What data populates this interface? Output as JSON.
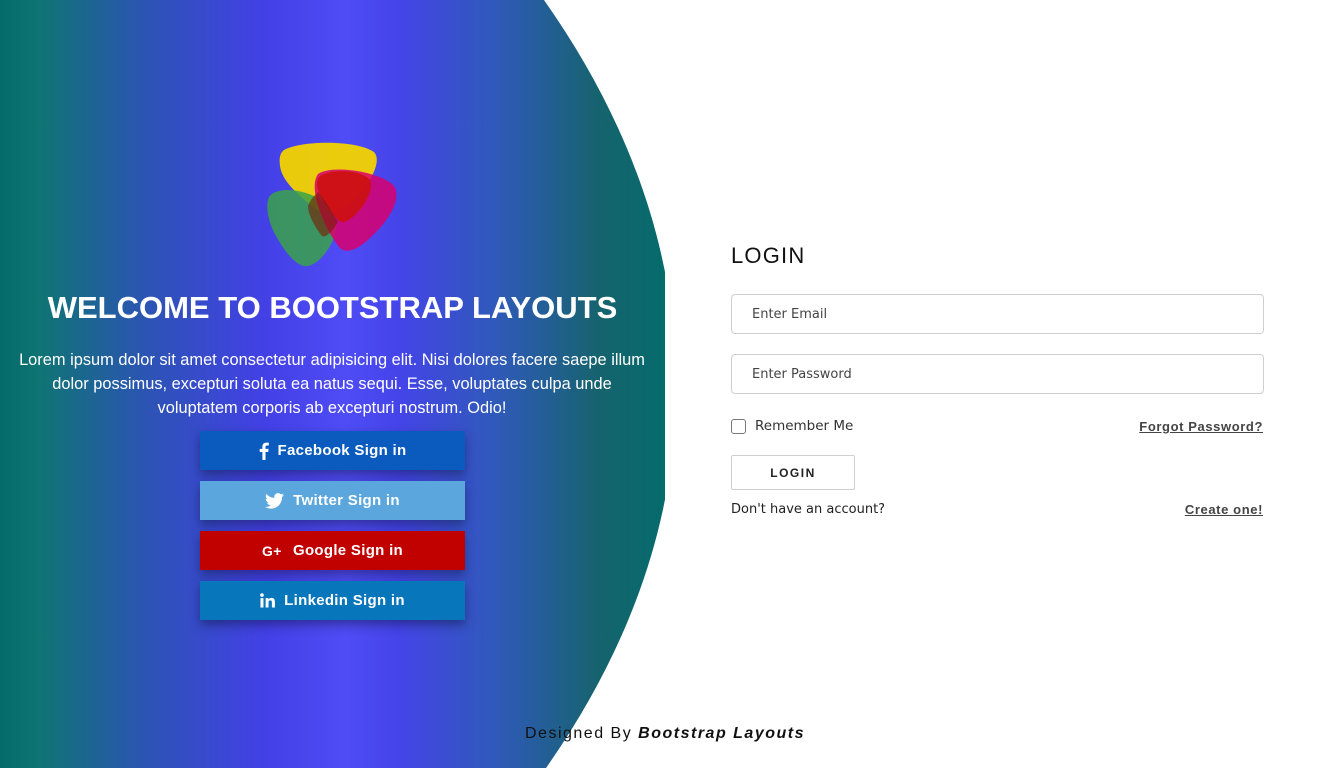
{
  "welcome": {
    "title": "WELCOME TO BOOTSTRAP LAYOUTS",
    "text": "Lorem ipsum dolor sit amet consectetur adipisicing elit. Nisi dolores facere saepe illum dolor possimus, excepturi soluta ea natus sequi. Esse, voluptates culpa unde voluptatem corporis ab excepturi nostrum. Odio!"
  },
  "social": {
    "facebook": {
      "label": "Facebook Sign in",
      "icon": "facebook-icon",
      "color": "#0b5bbf"
    },
    "twitter": {
      "label": "Twitter Sign in",
      "icon": "twitter-icon",
      "color": "#5aa6dd"
    },
    "google": {
      "label": "Google Sign in",
      "icon": "google-plus-icon",
      "color": "#c10000"
    },
    "linkedin": {
      "label": "Linkedin Sign in",
      "icon": "linkedin-icon",
      "color": "#0876bb"
    }
  },
  "login": {
    "heading": "LOGIN",
    "email_placeholder": "Enter Email",
    "password_placeholder": "Enter Password",
    "remember_label": "Remember Me",
    "forgot_label": "Forgot Password?",
    "button_label": "LOGIN",
    "no_account_text": "Don't have an account?",
    "create_label": "Create one!"
  },
  "footer": {
    "prefix": "Designed By",
    "brand": "Bootstrap Layouts"
  },
  "colors": {
    "panel_gradient_edge": "#056a6a",
    "panel_gradient_center": "#4f4cf6"
  }
}
